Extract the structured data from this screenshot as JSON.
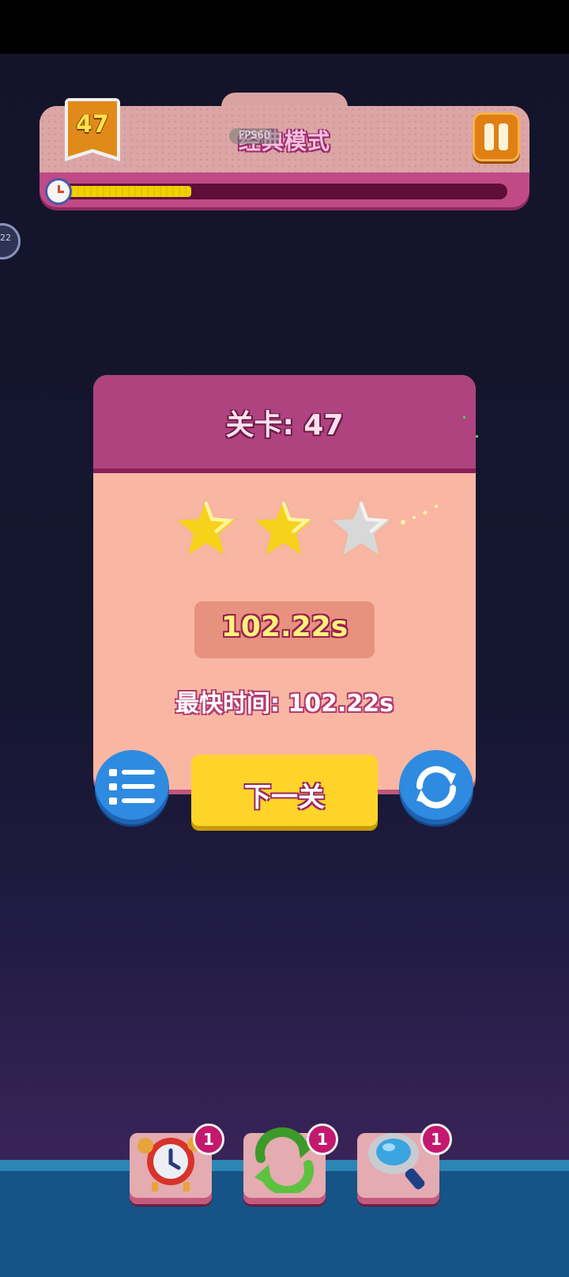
{
  "header": {
    "level": "47",
    "mode_title": "经典模式",
    "fps_label": "FPS60",
    "progress_fraction": 0.29
  },
  "side_bubble": {
    "text": "22"
  },
  "dialog": {
    "title": "关卡: 47",
    "stars_earned": 2,
    "stars_total": 3,
    "time": "102.22s",
    "best_time": "最快时间: 102.22s",
    "next_button": "下一关"
  },
  "tools": [
    {
      "name": "alarm-clock",
      "count": "1"
    },
    {
      "name": "shuffle",
      "count": "1"
    },
    {
      "name": "magnifier",
      "count": "1"
    }
  ],
  "colors": {
    "header_pink": "#dca6a6",
    "dialog_head": "#ae437f",
    "dialog_body": "#f9b7a3",
    "next_yellow": "#ffd42a",
    "round_blue": "#2f8be0"
  }
}
